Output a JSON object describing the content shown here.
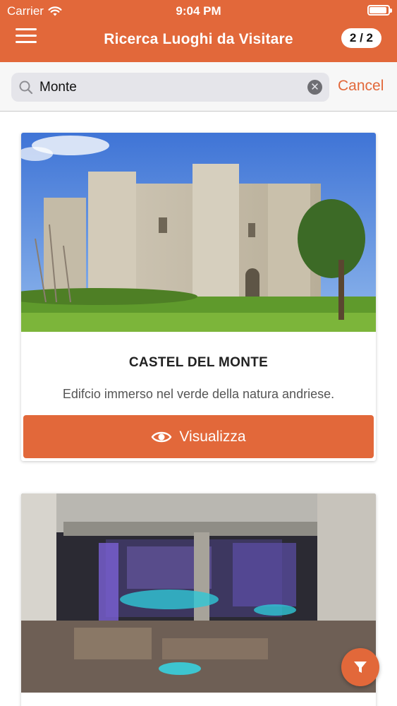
{
  "status_bar": {
    "carrier": "Carrier",
    "time": "9:04 PM",
    "battery_level": 1.0
  },
  "nav": {
    "title": "Ricerca Luoghi da Visitare",
    "pager": "2 / 2",
    "menu_icon": "hamburger-menu-icon"
  },
  "search": {
    "value": "Monte",
    "cancel_label": "Cancel",
    "clear_icon": "clear-circle-icon",
    "search_icon": "magnifier-icon"
  },
  "places": [
    {
      "title": "CASTEL DEL MONTE",
      "description": "Edifcio immerso nel verde della natura andriese.",
      "button_label": "Visualizza",
      "button_icon": "eye-icon"
    }
  ],
  "fab": {
    "icon": "filter-funnel-icon"
  },
  "colors": {
    "accent": "#e2683a",
    "search_bg": "#e5e5ea",
    "text_dark": "#222222"
  }
}
